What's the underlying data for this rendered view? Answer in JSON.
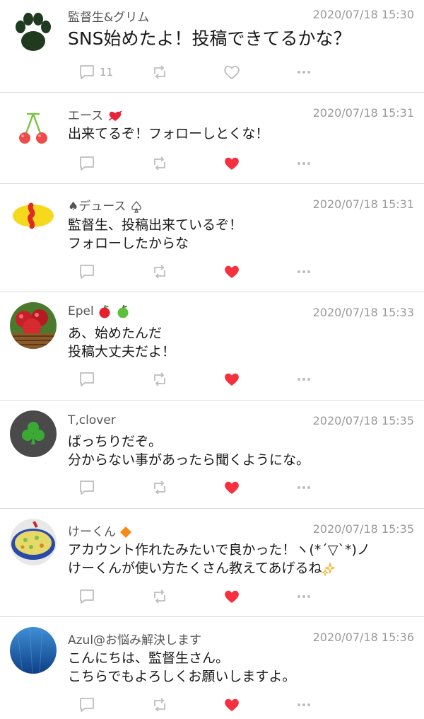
{
  "colors": {
    "like_active": "#f5303f",
    "icon_gray": "#bdbdbd",
    "divider": "#dcdcdc",
    "name_text": "#555555",
    "time_text": "#9a9a9a"
  },
  "posts": [
    {
      "author": "監督生&グリム",
      "time": "2020/07/18 15:30",
      "lines": [
        "SNS始めたよ！投稿できてるかな？"
      ],
      "reply_count": "11",
      "liked": false,
      "avatar_icon": "paw-icon"
    },
    {
      "author": "エース",
      "time": "2020/07/18 15:31",
      "lines": [
        "出来てるぞ！フォローしとくな！"
      ],
      "reply_count": "",
      "liked": true,
      "avatar_icon": "cherry-icon"
    },
    {
      "author": "♠デュース",
      "time": "2020/07/18 15:31",
      "lines": [
        "監督生、投稿出来ているぞ！",
        "フォローしたからな"
      ],
      "reply_count": "",
      "liked": true,
      "avatar_icon": "omelette-icon"
    },
    {
      "author": "Epel",
      "time": "2020/07/18 15:33",
      "lines": [
        "あ、始めたんだ",
        "投稿大丈夫だよ！"
      ],
      "reply_count": "",
      "liked": true,
      "avatar_icon": "apple-basket-icon"
    },
    {
      "author": "T,clover",
      "time": "2020/07/18 15:35",
      "lines": [
        "ばっちりだぞ。",
        "分からない事があったら聞くようにな。"
      ],
      "reply_count": "",
      "liked": true,
      "avatar_icon": "clover-icon"
    },
    {
      "author": "けーくん",
      "time": "2020/07/18 15:35",
      "lines": [
        "アカウント作れたみたいで良かった！ヽ(*´▽`*)ノ",
        "けーくんが使い方たくさん教えてあげるね"
      ],
      "reply_count": "",
      "liked": true,
      "avatar_icon": "paella-icon"
    },
    {
      "author": "Azul@お悩み解決します",
      "time": "2020/07/18 15:36",
      "lines": [
        "こんにちは、監督生さん。",
        "こちらでもよろしくお願いしますよ。"
      ],
      "reply_count": "",
      "liked": true,
      "avatar_icon": "ocean-icon"
    }
  ]
}
